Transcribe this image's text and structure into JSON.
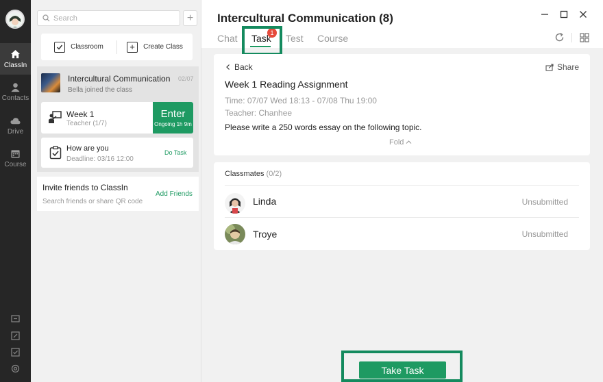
{
  "rail": {
    "items": [
      {
        "label": "ClassIn",
        "icon": "home-icon"
      },
      {
        "label": "Contacts",
        "icon": "person-icon"
      },
      {
        "label": "Drive",
        "icon": "cloud-icon"
      },
      {
        "label": "Course",
        "icon": "calendar-icon"
      }
    ]
  },
  "list": {
    "search_placeholder": "Search",
    "actions": {
      "classroom": "Classroom",
      "create_class": "Create Class"
    },
    "group": {
      "title": "Intercultural Communication",
      "date": "02/07",
      "subtitle": "Bella joined the class"
    },
    "class_item": {
      "name": "Week 1",
      "role": "Teacher (1/7)",
      "enter_label": "Enter",
      "enter_status": "Ongoing 1h 9m"
    },
    "task_item": {
      "name": "How are you",
      "deadline": "Deadline: 03/16 12:00",
      "action": "Do Task"
    },
    "invite": {
      "title": "Invite friends to ClassIn",
      "subtitle": "Search friends or share QR code",
      "action": "Add Friends"
    }
  },
  "main": {
    "title": "Intercultural Communication (8)",
    "tabs": [
      {
        "label": "Chat"
      },
      {
        "label": "Task",
        "badge": "1"
      },
      {
        "label": "Test"
      },
      {
        "label": "Course"
      }
    ],
    "detail": {
      "back": "Back",
      "share": "Share",
      "title": "Week 1 Reading Assignment",
      "time": "Time:  07/07 Wed 18:13 - 07/08 Thu 19:00",
      "teacher": "Teacher:  Chanhee",
      "description": "Please write a 250 words essay on the following topic.",
      "fold": "Fold"
    },
    "classmates": {
      "label": "Classmates",
      "count": "(0/2)",
      "items": [
        {
          "name": "Linda",
          "status": "Unsubmitted"
        },
        {
          "name": "Troye",
          "status": "Unsubmitted"
        }
      ]
    },
    "take_task": "Take Task"
  },
  "colors": {
    "accent": "#1e9a62",
    "highlight": "#148a5e",
    "badge": "#e64b3c",
    "rail": "#262626"
  }
}
